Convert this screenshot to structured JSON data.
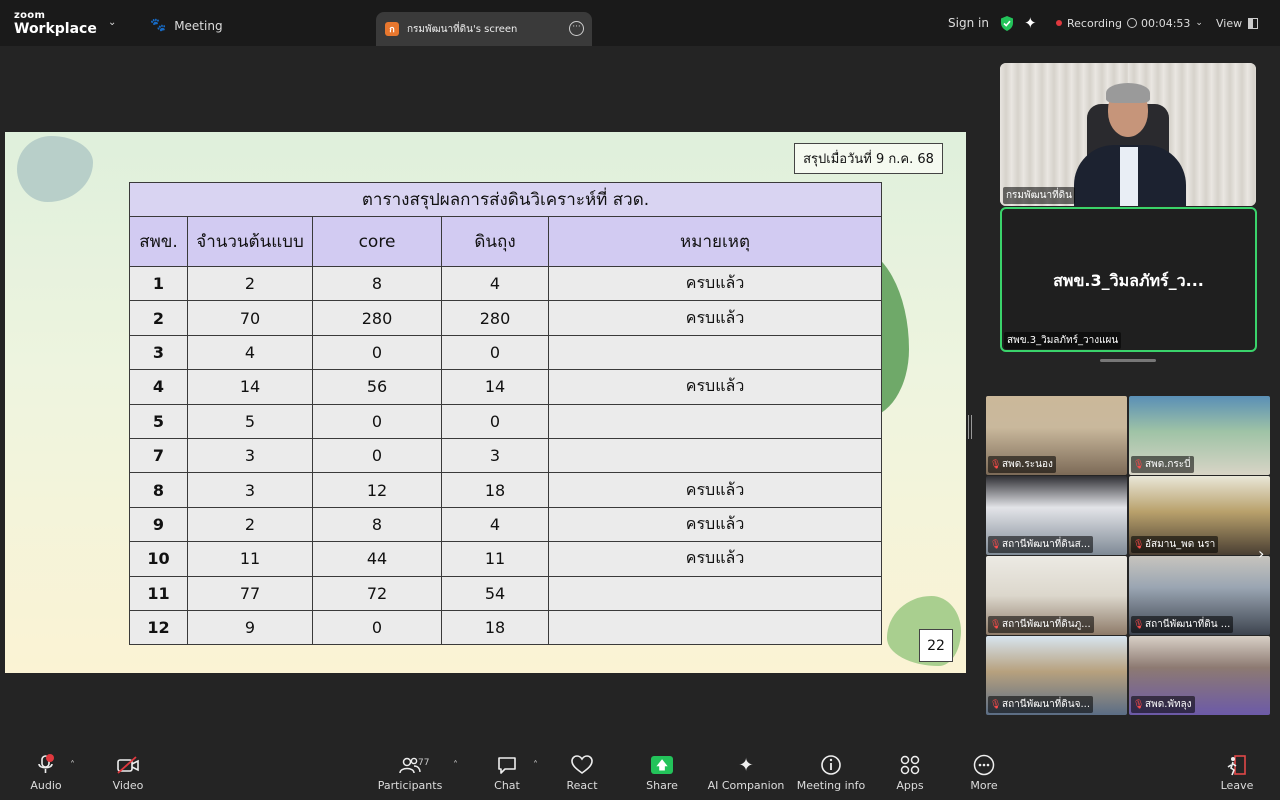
{
  "app": {
    "brand_top": "zoom",
    "brand_bottom": "Workplace",
    "meeting_label": "Meeting",
    "share_tab_initial": "ก",
    "share_tab_label": "กรมพัฒนาที่ดิน's screen",
    "sign_in": "Sign in",
    "recording": "Recording",
    "timer": "00:04:53",
    "view": "View"
  },
  "slide": {
    "date_note": "สรุปเมื่อวันที่ 9 ก.ค. 68",
    "page_number": "22",
    "table_title": "ตารางสรุปผลการส่งดินวิเคราะห์ที่ สวด.",
    "headers": [
      "สพข.",
      "จำนวนต้นแบบ",
      "core",
      "ดินถุง",
      "หมายเหตุ"
    ],
    "rows": [
      [
        "1",
        "2",
        "8",
        "4",
        "ครบแล้ว"
      ],
      [
        "2",
        "70",
        "280",
        "280",
        "ครบแล้ว"
      ],
      [
        "3",
        "4",
        "0",
        "0",
        ""
      ],
      [
        "4",
        "14",
        "56",
        "14",
        "ครบแล้ว"
      ],
      [
        "5",
        "5",
        "0",
        "0",
        ""
      ],
      [
        "7",
        "3",
        "0",
        "3",
        ""
      ],
      [
        "8",
        "3",
        "12",
        "18",
        "ครบแล้ว"
      ],
      [
        "9",
        "2",
        "8",
        "4",
        "ครบแล้ว"
      ],
      [
        "10",
        "11",
        "44",
        "11",
        "ครบแล้ว"
      ],
      [
        "11",
        "77",
        "72",
        "54",
        ""
      ],
      [
        "12",
        "9",
        "0",
        "18",
        ""
      ]
    ]
  },
  "speaker": {
    "name": "กรมพัฒนาที่ดิน"
  },
  "active_tile": {
    "big_name": "สพข.3_วิมลภัทร์_ว...",
    "name": "สพข.3_วิมลภัทร์_วางแผน"
  },
  "gallery": [
    {
      "name": "สพด.ระนอง",
      "scene": "room1"
    },
    {
      "name": "สพด.กระบี่",
      "scene": "room2"
    },
    {
      "name": "สถานีพัฒนาที่ดินส...",
      "scene": "room3"
    },
    {
      "name": "อัสมาน_พด นรา",
      "scene": "room4"
    },
    {
      "name": "สถานีพัฒนาที่ดินภู...",
      "scene": "room5"
    },
    {
      "name": "สถานีพัฒนาที่ดิน ...",
      "scene": "room6"
    },
    {
      "name": "สถานีพัฒนาที่ดินจ...",
      "scene": "room7"
    },
    {
      "name": "สพด.พัทลุง",
      "scene": "room8"
    }
  ],
  "toolbar": {
    "audio": "Audio",
    "video": "Video",
    "participants": "Participants",
    "participants_count": "77",
    "chat": "Chat",
    "react": "React",
    "share": "Share",
    "ai_companion": "AI Companion",
    "meeting_info": "Meeting info",
    "apps": "Apps",
    "more": "More",
    "leave": "Leave"
  },
  "colors": {
    "accent_green": "#3ad36b",
    "share_green": "#23c35a",
    "record_red": "#e0383e",
    "table_header": "#d2cbf2"
  }
}
